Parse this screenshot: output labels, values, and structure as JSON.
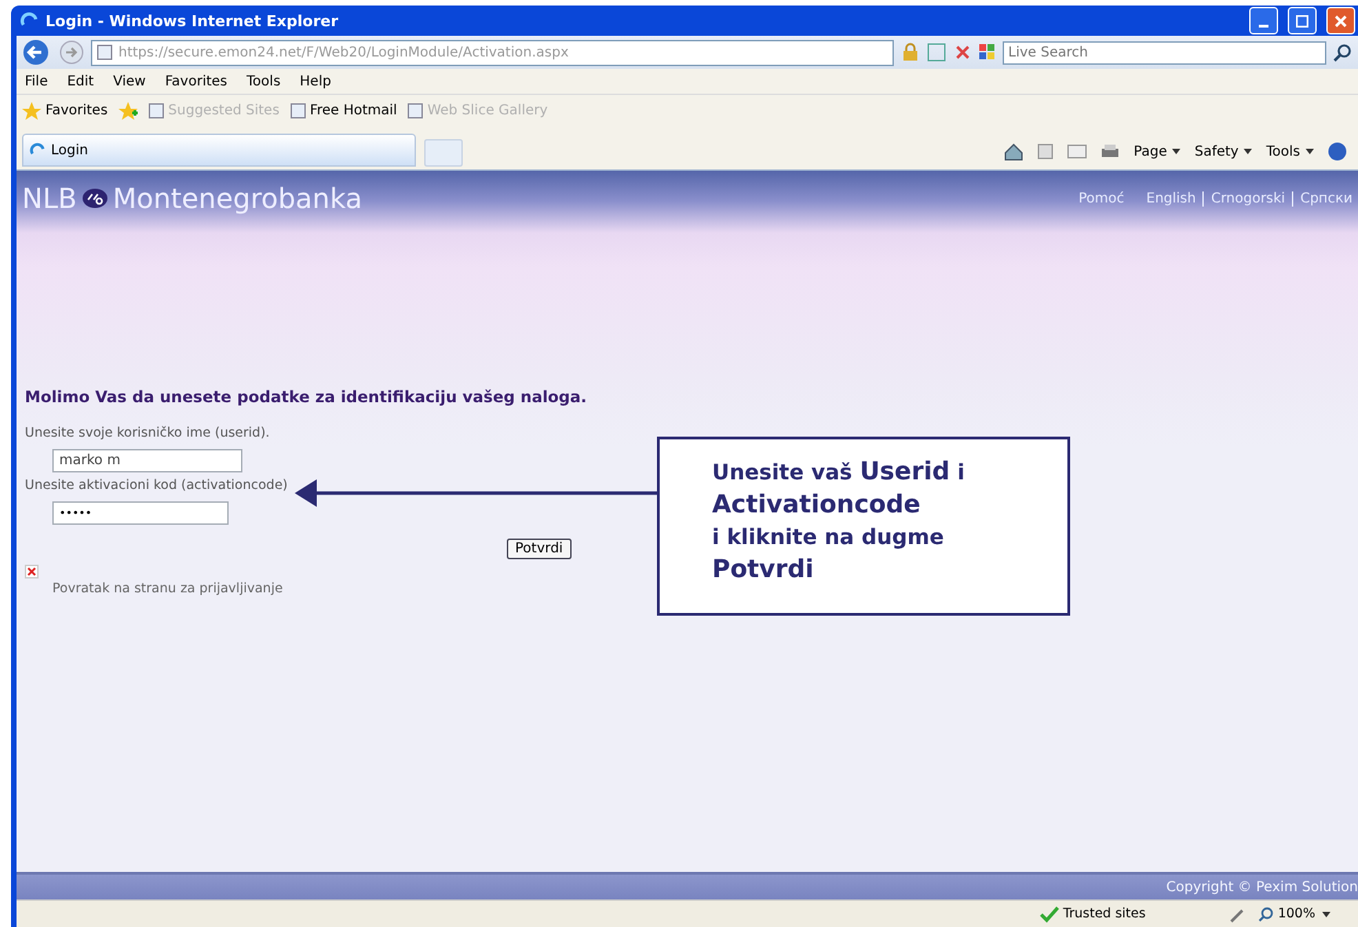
{
  "window": {
    "title": "Login - Windows Internet Explorer"
  },
  "address_bar": {
    "url": "https://secure.emon24.net/F/Web20/LoginModule/Activation.aspx"
  },
  "search": {
    "placeholder": "Live Search"
  },
  "menu": [
    "File",
    "Edit",
    "View",
    "Favorites",
    "Tools",
    "Help"
  ],
  "favorites_bar": {
    "label": "Favorites",
    "items": [
      {
        "label": "Suggested Sites",
        "disabled": true
      },
      {
        "label": "Free Hotmail",
        "disabled": false
      },
      {
        "label": "Web Slice Gallery",
        "disabled": true
      }
    ]
  },
  "tabs": [
    {
      "label": "Login",
      "selected": true
    }
  ],
  "command_bar": [
    "Page",
    "Safety",
    "Tools"
  ],
  "page": {
    "logo": {
      "prefix": "NLB",
      "name": "Montenegrobanka"
    },
    "help_link": "Pomoć",
    "languages": [
      "English",
      "Crnogorski",
      "Српски"
    ],
    "heading": "Molimo Vas da unesete podatke za identifikaciju vašeg naloga.",
    "fields": [
      {
        "kind": "text",
        "label": "Unesite svoje korisničko ime (userid).",
        "value": "marko m"
      },
      {
        "kind": "password",
        "label": "Unesite aktivacioni kod (activationcode)",
        "value": "•••••"
      }
    ],
    "submit": "Potvrdi",
    "back_link": "Povratak na stranu za prijavljivanje",
    "footer": "Copyright © Pexim Solution"
  },
  "callout": {
    "lines": [
      "Unesite vaš **Userid** i",
      "**Activationcode**",
      "i kliknite na dugme",
      "**Potvrdi**"
    ]
  },
  "status_bar": {
    "zone": "Trusted sites",
    "zoom": "100%"
  }
}
